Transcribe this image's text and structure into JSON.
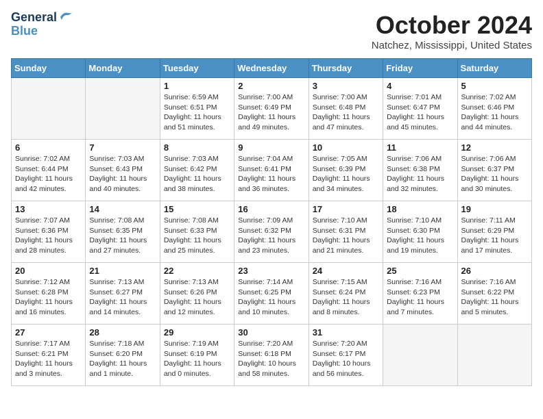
{
  "header": {
    "logo_line1": "General",
    "logo_line2": "Blue",
    "month": "October 2024",
    "location": "Natchez, Mississippi, United States"
  },
  "weekdays": [
    "Sunday",
    "Monday",
    "Tuesday",
    "Wednesday",
    "Thursday",
    "Friday",
    "Saturday"
  ],
  "weeks": [
    [
      {
        "day": "",
        "info": ""
      },
      {
        "day": "",
        "info": ""
      },
      {
        "day": "1",
        "info": "Sunrise: 6:59 AM\nSunset: 6:51 PM\nDaylight: 11 hours and 51 minutes."
      },
      {
        "day": "2",
        "info": "Sunrise: 7:00 AM\nSunset: 6:49 PM\nDaylight: 11 hours and 49 minutes."
      },
      {
        "day": "3",
        "info": "Sunrise: 7:00 AM\nSunset: 6:48 PM\nDaylight: 11 hours and 47 minutes."
      },
      {
        "day": "4",
        "info": "Sunrise: 7:01 AM\nSunset: 6:47 PM\nDaylight: 11 hours and 45 minutes."
      },
      {
        "day": "5",
        "info": "Sunrise: 7:02 AM\nSunset: 6:46 PM\nDaylight: 11 hours and 44 minutes."
      }
    ],
    [
      {
        "day": "6",
        "info": "Sunrise: 7:02 AM\nSunset: 6:44 PM\nDaylight: 11 hours and 42 minutes."
      },
      {
        "day": "7",
        "info": "Sunrise: 7:03 AM\nSunset: 6:43 PM\nDaylight: 11 hours and 40 minutes."
      },
      {
        "day": "8",
        "info": "Sunrise: 7:03 AM\nSunset: 6:42 PM\nDaylight: 11 hours and 38 minutes."
      },
      {
        "day": "9",
        "info": "Sunrise: 7:04 AM\nSunset: 6:41 PM\nDaylight: 11 hours and 36 minutes."
      },
      {
        "day": "10",
        "info": "Sunrise: 7:05 AM\nSunset: 6:39 PM\nDaylight: 11 hours and 34 minutes."
      },
      {
        "day": "11",
        "info": "Sunrise: 7:06 AM\nSunset: 6:38 PM\nDaylight: 11 hours and 32 minutes."
      },
      {
        "day": "12",
        "info": "Sunrise: 7:06 AM\nSunset: 6:37 PM\nDaylight: 11 hours and 30 minutes."
      }
    ],
    [
      {
        "day": "13",
        "info": "Sunrise: 7:07 AM\nSunset: 6:36 PM\nDaylight: 11 hours and 28 minutes."
      },
      {
        "day": "14",
        "info": "Sunrise: 7:08 AM\nSunset: 6:35 PM\nDaylight: 11 hours and 27 minutes."
      },
      {
        "day": "15",
        "info": "Sunrise: 7:08 AM\nSunset: 6:33 PM\nDaylight: 11 hours and 25 minutes."
      },
      {
        "day": "16",
        "info": "Sunrise: 7:09 AM\nSunset: 6:32 PM\nDaylight: 11 hours and 23 minutes."
      },
      {
        "day": "17",
        "info": "Sunrise: 7:10 AM\nSunset: 6:31 PM\nDaylight: 11 hours and 21 minutes."
      },
      {
        "day": "18",
        "info": "Sunrise: 7:10 AM\nSunset: 6:30 PM\nDaylight: 11 hours and 19 minutes."
      },
      {
        "day": "19",
        "info": "Sunrise: 7:11 AM\nSunset: 6:29 PM\nDaylight: 11 hours and 17 minutes."
      }
    ],
    [
      {
        "day": "20",
        "info": "Sunrise: 7:12 AM\nSunset: 6:28 PM\nDaylight: 11 hours and 16 minutes."
      },
      {
        "day": "21",
        "info": "Sunrise: 7:13 AM\nSunset: 6:27 PM\nDaylight: 11 hours and 14 minutes."
      },
      {
        "day": "22",
        "info": "Sunrise: 7:13 AM\nSunset: 6:26 PM\nDaylight: 11 hours and 12 minutes."
      },
      {
        "day": "23",
        "info": "Sunrise: 7:14 AM\nSunset: 6:25 PM\nDaylight: 11 hours and 10 minutes."
      },
      {
        "day": "24",
        "info": "Sunrise: 7:15 AM\nSunset: 6:24 PM\nDaylight: 11 hours and 8 minutes."
      },
      {
        "day": "25",
        "info": "Sunrise: 7:16 AM\nSunset: 6:23 PM\nDaylight: 11 hours and 7 minutes."
      },
      {
        "day": "26",
        "info": "Sunrise: 7:16 AM\nSunset: 6:22 PM\nDaylight: 11 hours and 5 minutes."
      }
    ],
    [
      {
        "day": "27",
        "info": "Sunrise: 7:17 AM\nSunset: 6:21 PM\nDaylight: 11 hours and 3 minutes."
      },
      {
        "day": "28",
        "info": "Sunrise: 7:18 AM\nSunset: 6:20 PM\nDaylight: 11 hours and 1 minute."
      },
      {
        "day": "29",
        "info": "Sunrise: 7:19 AM\nSunset: 6:19 PM\nDaylight: 11 hours and 0 minutes."
      },
      {
        "day": "30",
        "info": "Sunrise: 7:20 AM\nSunset: 6:18 PM\nDaylight: 10 hours and 58 minutes."
      },
      {
        "day": "31",
        "info": "Sunrise: 7:20 AM\nSunset: 6:17 PM\nDaylight: 10 hours and 56 minutes."
      },
      {
        "day": "",
        "info": ""
      },
      {
        "day": "",
        "info": ""
      }
    ]
  ]
}
